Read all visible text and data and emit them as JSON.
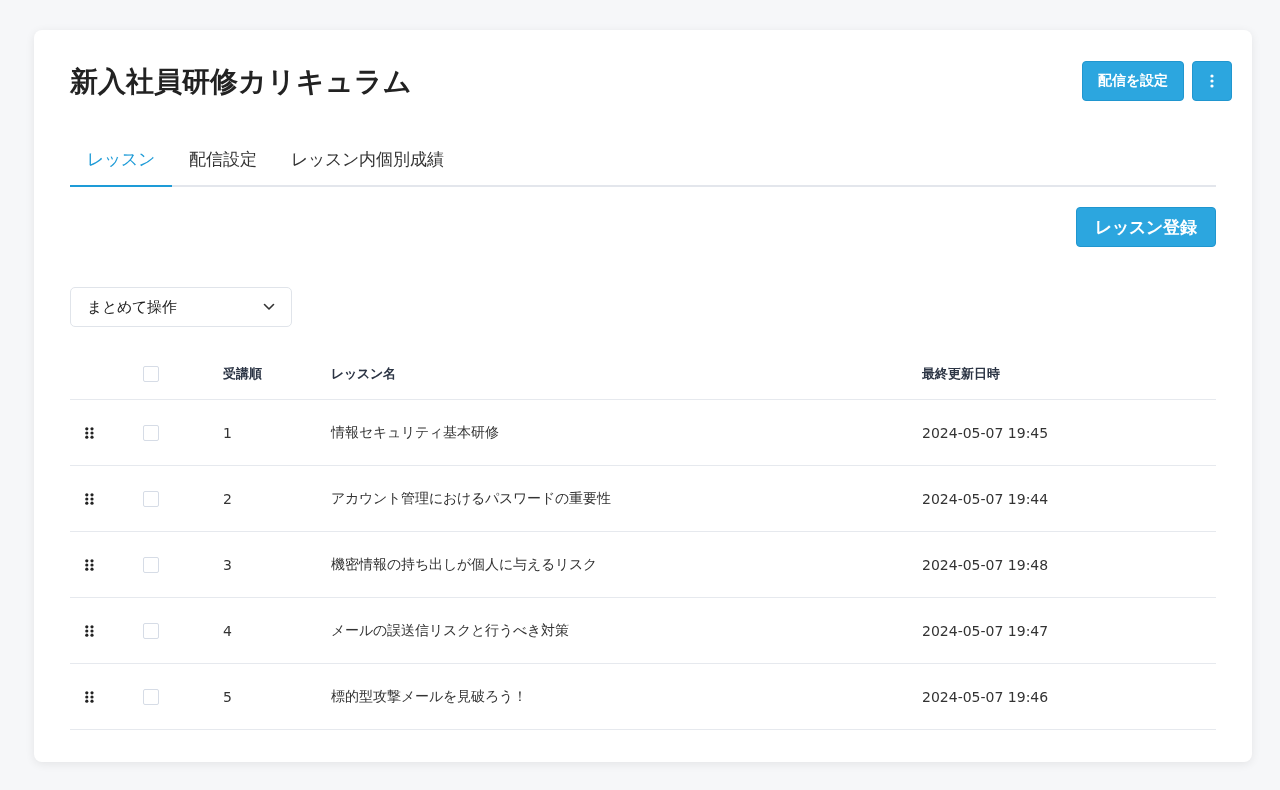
{
  "title": "新入社員研修カリキュラム",
  "header_buttons": {
    "primary": "配信を設定"
  },
  "tabs": [
    {
      "label": "レッスン",
      "selected": true
    },
    {
      "label": "配信設定",
      "selected": false
    },
    {
      "label": "レッスン内個別成績",
      "selected": false
    }
  ],
  "register_button": "レッスン登録",
  "bulk_action": {
    "value": "まとめて操作"
  },
  "table": {
    "select_all": {
      "checked": false
    },
    "columns": [
      "受講順",
      "レッスン名",
      "最終更新日時"
    ],
    "rows": [
      {
        "checked": false,
        "order": "1",
        "name": "情報セキュリティ基本研修",
        "updated": "2024-05-07 19:45"
      },
      {
        "checked": false,
        "order": "2",
        "name": "アカウント管理におけるパスワードの重要性",
        "updated": "2024-05-07 19:44"
      },
      {
        "checked": false,
        "order": "3",
        "name": "機密情報の持ち出しが個人に与えるリスク",
        "updated": "2024-05-07 19:48"
      },
      {
        "checked": false,
        "order": "4",
        "name": "メールの誤送信リスクと行うべき対策",
        "updated": "2024-05-07 19:47"
      },
      {
        "checked": false,
        "order": "5",
        "name": "標的型攻撃メールを見破ろう！",
        "updated": "2024-05-07 19:46"
      }
    ]
  }
}
